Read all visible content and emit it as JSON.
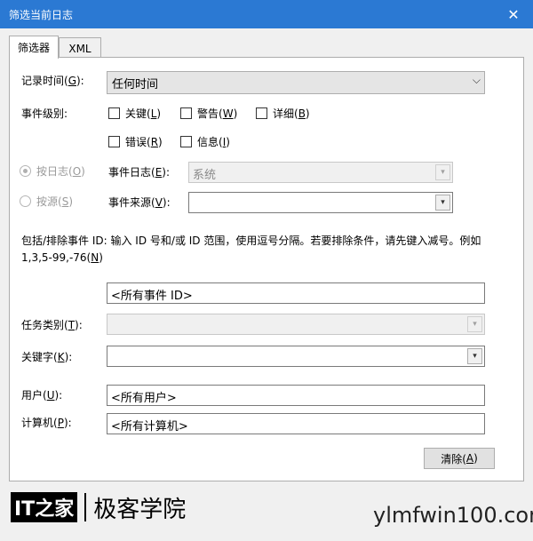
{
  "window": {
    "title": "筛选当前日志",
    "close": "✕"
  },
  "tabs": [
    {
      "label": "筛选器"
    },
    {
      "label": "XML"
    }
  ],
  "logged": {
    "label_pre": "记录时间(",
    "hotkey": "G",
    "label_post": "):",
    "value": "任何时间"
  },
  "event_level": {
    "label": "事件级别:",
    "options": [
      {
        "pre": "关键(",
        "key": "L",
        "post": ")"
      },
      {
        "pre": "警告(",
        "key": "W",
        "post": ")"
      },
      {
        "pre": "详细(",
        "key": "B",
        "post": ")"
      },
      {
        "pre": "错误(",
        "key": "R",
        "post": ")"
      },
      {
        "pre": "信息(",
        "key": "I",
        "post": ")"
      }
    ]
  },
  "by_log": {
    "pre": "按日志(",
    "key": "O",
    "post": ")"
  },
  "by_source": {
    "pre": "按源(",
    "key": "S",
    "post": ")"
  },
  "event_logs": {
    "pre": "事件日志(",
    "key": "E",
    "post": "):",
    "value": "系统"
  },
  "event_sources": {
    "pre": "事件来源(",
    "key": "V",
    "post": "):",
    "value": ""
  },
  "description": {
    "text": "包括/排除事件 ID: 输入 ID 号和/或 ID 范围，使用逗号分隔。若要排除条件，请先键入减号。例如 1,3,5-99,-76(",
    "key": "N",
    "post": ")"
  },
  "event_ids": {
    "value": "<所有事件 ID>"
  },
  "task_category": {
    "pre": "任务类别(",
    "key": "T",
    "post": "):"
  },
  "keywords": {
    "pre": "关键字(",
    "key": "K",
    "post": "):"
  },
  "user": {
    "pre": "用户(",
    "key": "U",
    "post": "):",
    "value": "<所有用户>"
  },
  "computer": {
    "pre": "计算机(",
    "key": "P",
    "post": "):",
    "value": "<所有计算机>"
  },
  "clear_button": {
    "pre": "清除(",
    "key": "A",
    "post": ")"
  },
  "icons": {
    "dropdown": "▾",
    "combo_arrow": "⌵"
  },
  "watermark": {
    "logo": "IT之家",
    "text": "极客学院",
    "site": "ylmfwin100.com"
  },
  "colors": {
    "titlebar": "#2b79d3",
    "window_bg": "#f0f0f0"
  }
}
